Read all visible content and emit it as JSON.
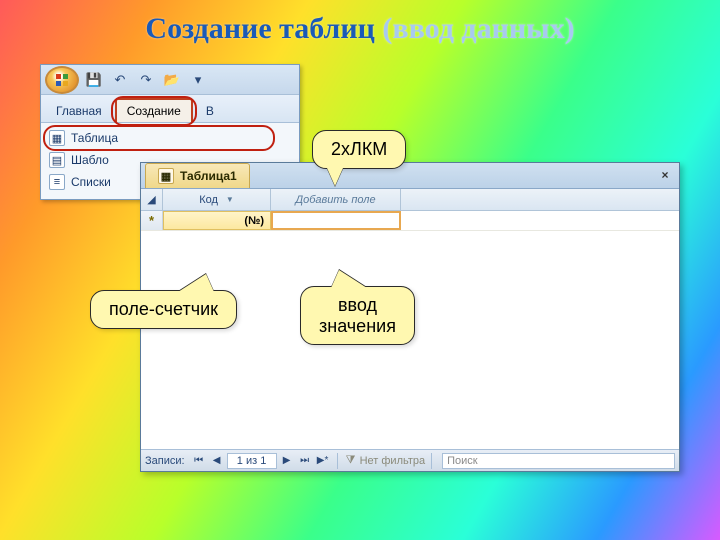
{
  "slide": {
    "title_outer": "Создание таблиц ",
    "title_inner": "(ввод данных)"
  },
  "ribbon": {
    "tabs": {
      "home": "Главная",
      "create": "Создание",
      "extra": "В"
    },
    "items": {
      "table": "Таблица",
      "templates": "Шабло",
      "lists": "Списки"
    }
  },
  "datasheet": {
    "tab_label": "Таблица1",
    "col_code": "Код",
    "col_add": "Добавить поле",
    "new_row_marker": "*",
    "first_value": "(№)",
    "nav": {
      "label": "Записи:",
      "position": "1 из 1",
      "filter": "Нет фильтра",
      "search_placeholder": "Поиск"
    }
  },
  "callouts": {
    "dblclick": "2хЛКМ",
    "counter": "поле-счетчик",
    "value": "ввод\nзначения"
  }
}
